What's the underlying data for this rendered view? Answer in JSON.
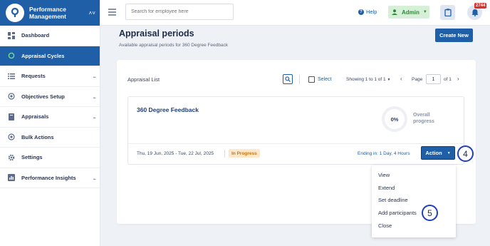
{
  "brand": {
    "title_line1": "Performance",
    "title_line2": "Management"
  },
  "sidebar": {
    "items": [
      {
        "label": "Dashboard",
        "icon": "dashboard-icon"
      },
      {
        "label": "Appraisal Cycles",
        "icon": "cycle-icon",
        "active": true
      },
      {
        "label": "Requests",
        "icon": "list-icon",
        "more": "..."
      },
      {
        "label": "Objectives Setup",
        "icon": "target-icon",
        "more": "..."
      },
      {
        "label": "Appraisals",
        "icon": "book-icon",
        "more": "..."
      },
      {
        "label": "Bulk Actions",
        "icon": "target-icon"
      },
      {
        "label": "Settings",
        "icon": "gear-icon"
      },
      {
        "label": "Performance Insights",
        "icon": "chart-icon",
        "more": "..."
      }
    ]
  },
  "topbar": {
    "search_placeholder": "Search for employee here",
    "help_label": "Help",
    "admin_label": "Admin",
    "notification_count": "2744"
  },
  "page": {
    "title": "Appraisal periods",
    "subtitle": "Available appraisal periods for 360 Degree Feedback",
    "create_button": "Create New"
  },
  "list": {
    "title": "Appraisal List",
    "select_label": "Select",
    "showing": "Showing 1 to 1 of 1",
    "page_label": "Page",
    "page_value": "1",
    "of_label": "of  1"
  },
  "cycle": {
    "name": "360 Degree Feedback",
    "progress": "0%",
    "progress_label_1": "Overall",
    "progress_label_2": "progress",
    "dates": "Thu, 19 Jun, 2025 - Tue, 22 Jul, 2025",
    "status": "In Progress",
    "ending": "Ending in: 1 Day, 4 Hours",
    "action_label": "Action"
  },
  "dropdown": {
    "items": [
      "View",
      "Extend",
      "Set deadline",
      "Add participants",
      "Close"
    ]
  },
  "callouts": {
    "action": "4",
    "add_participants": "5"
  },
  "colors": {
    "primary": "#1f5fa8",
    "status_bg": "#fde8cc",
    "status_text": "#c2761a",
    "badge": "#d8312f"
  }
}
